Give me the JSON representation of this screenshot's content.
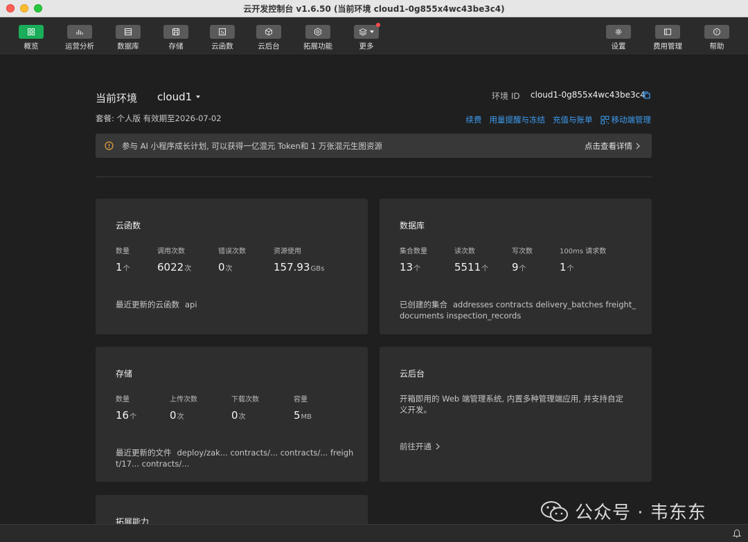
{
  "window": {
    "title": "云开发控制台 v1.6.50 (当前环境 cloud1-0g855x4wc43be3c4)"
  },
  "toolbar": {
    "left": [
      {
        "label": "概览",
        "icon": "grid-icon",
        "active": true
      },
      {
        "label": "运营分析",
        "icon": "bar-chart-icon"
      },
      {
        "label": "数据库",
        "icon": "database-icon"
      },
      {
        "label": "存储",
        "icon": "save-icon"
      },
      {
        "label": "云函数",
        "icon": "function-icon"
      },
      {
        "label": "云后台",
        "icon": "cube-icon"
      },
      {
        "label": "拓展功能",
        "icon": "extension-icon"
      },
      {
        "label": "更多",
        "icon": "layers-icon"
      }
    ],
    "right": [
      {
        "label": "设置",
        "icon": "gear-icon"
      },
      {
        "label": "费用管理",
        "icon": "billing-icon"
      },
      {
        "label": "帮助",
        "icon": "help-icon"
      }
    ]
  },
  "env": {
    "label": "当前环境",
    "name": "cloud1",
    "id_label": "环境 ID",
    "id": "cloud1-0g855x4wc43be3c4",
    "plan": "套餐: 个人版   有效期至2026-07-02"
  },
  "links": {
    "renew": "续费",
    "usage": "用量提醒与冻结",
    "recharge": "充值与账单",
    "mobile": "移动端管理"
  },
  "notice": {
    "text": "参与 AI 小程序成长计划, 可以获得一亿混元 Token和 1 万张混元生图资源",
    "more": "点击查看详情"
  },
  "cards": {
    "functions": {
      "title": "云函数",
      "stats": [
        {
          "label": "数量",
          "value": "1",
          "unit": "个"
        },
        {
          "label": "调用次数",
          "value": "6022",
          "unit": "次"
        },
        {
          "label": "错误次数",
          "value": "0",
          "unit": "次"
        },
        {
          "label": "资源使用",
          "value": "157.93",
          "unit": "GBs"
        }
      ],
      "foot_label": "最近更新的云函数",
      "foot_value": "api"
    },
    "database": {
      "title": "数据库",
      "stats": [
        {
          "label": "集合数量",
          "value": "13",
          "unit": "个"
        },
        {
          "label": "读次数",
          "value": "5511",
          "unit": "个"
        },
        {
          "label": "写次数",
          "value": "9",
          "unit": "个"
        },
        {
          "label": "100ms 请求数",
          "value": "1",
          "unit": "个"
        }
      ],
      "foot_label": "已创建的集合",
      "foot_line1": "addresses contracts delivery_batches freight_",
      "foot_line2": "documents inspection_records"
    },
    "storage": {
      "title": "存储",
      "stats": [
        {
          "label": "数量",
          "value": "16",
          "unit": "个"
        },
        {
          "label": "上传次数",
          "value": "0",
          "unit": "次"
        },
        {
          "label": "下载次数",
          "value": "0",
          "unit": "次"
        },
        {
          "label": "容量",
          "value": "5",
          "unit": "MB"
        }
      ],
      "foot_label": "最近更新的文件",
      "foot_line1": "deploy/zak...  contracts/...  contracts/...  freigh",
      "foot_line2": "t/17...  contracts/..."
    },
    "backend": {
      "title": "云后台",
      "desc_line1": "开箱即用的 Web 端管理系统, 内置多种管理端应用, 并支持自定",
      "desc_line2": "义开发。",
      "link": "前往开通"
    },
    "extensions": {
      "title": "拓展能力"
    }
  },
  "watermark": "公众号 · 韦东东",
  "colors": {
    "accent": "#1aad5a",
    "link": "#3d9cf0",
    "card": "#2e2e2e",
    "warning": "#e6a23c"
  }
}
